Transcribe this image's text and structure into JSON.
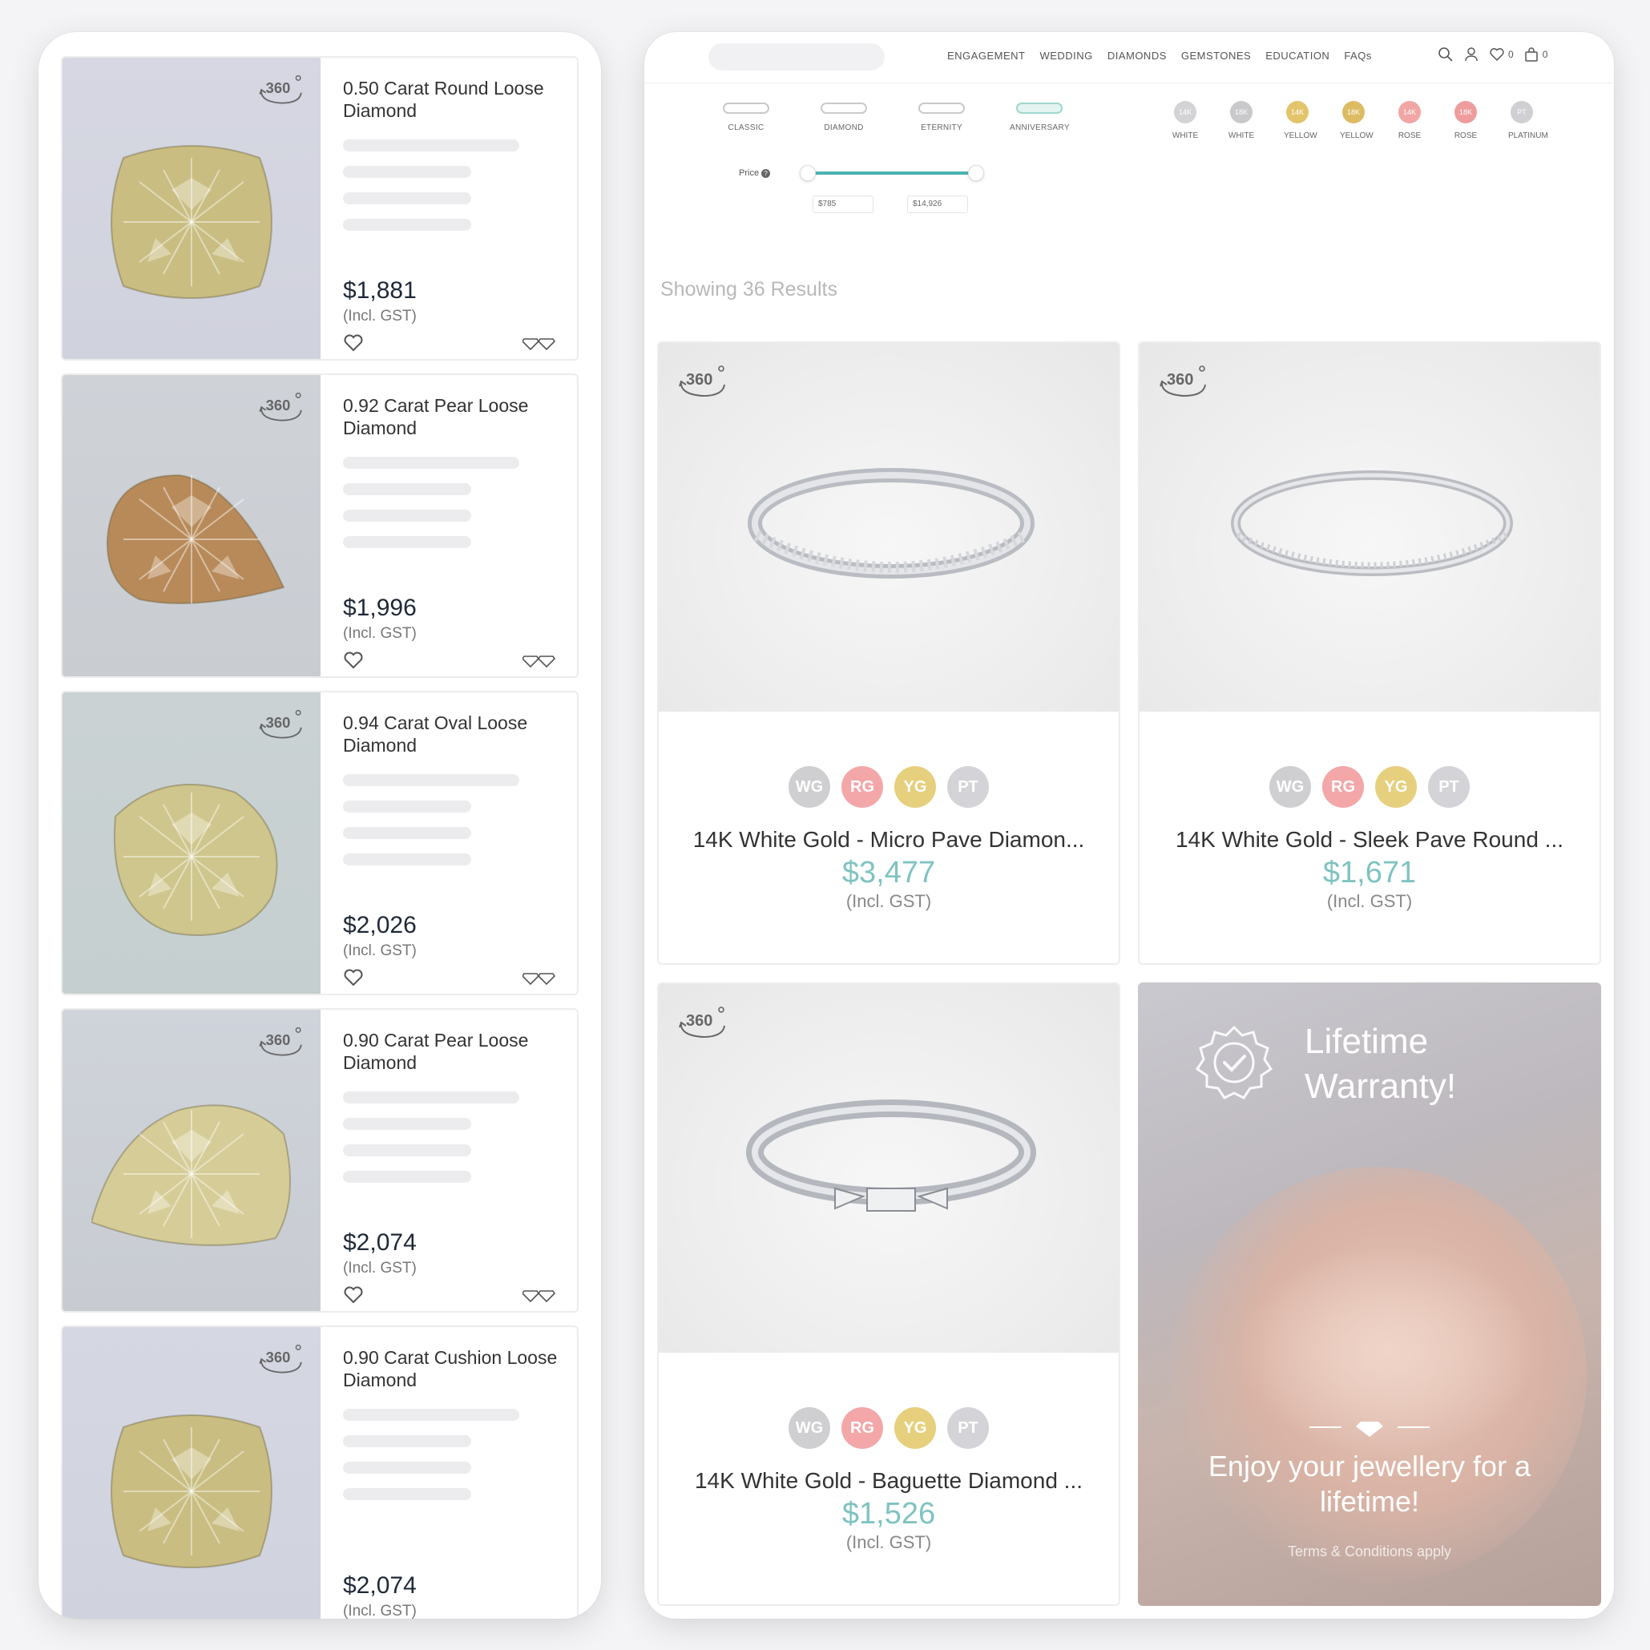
{
  "diamonds": [
    {
      "title": "0.50 Carat Round Loose Diamond",
      "price": "$1,881",
      "gst": "(Incl. GST)",
      "badge": "360",
      "gem_color": "#c9bd82"
    },
    {
      "title": "0.92 Carat Pear Loose Diamond",
      "price": "$1,996",
      "gst": "(Incl. GST)",
      "badge": "360",
      "gem_color": "#b88a5a"
    },
    {
      "title": "0.94 Carat Oval Loose Diamond",
      "price": "$2,026",
      "gst": "(Incl. GST)",
      "badge": "360",
      "gem_color": "#cfc68d"
    },
    {
      "title": "0.90 Carat Pear Loose Diamond",
      "price": "$2,074",
      "gst": "(Incl. GST)",
      "badge": "360",
      "gem_color": "#d6cc97"
    },
    {
      "title": "0.90 Carat Cushion Loose Diamond",
      "price": "$2,074",
      "gst": "(Incl. GST)",
      "badge": "360",
      "gem_color": "#c9bd82"
    }
  ],
  "nav": {
    "items": [
      "ENGAGEMENT",
      "WEDDING",
      "DIAMONDS",
      "GEMSTONES",
      "EDUCATION",
      "FAQs"
    ],
    "wishlist_count": "0",
    "cart_count": "0"
  },
  "filters": {
    "styles": [
      {
        "label": "CLASSIC",
        "active": false
      },
      {
        "label": "DIAMOND",
        "active": false
      },
      {
        "label": "ETERNITY",
        "active": false
      },
      {
        "label": "ANNIVERSARY",
        "active": true
      }
    ],
    "metals": [
      {
        "code": "14K",
        "label": "WHITE",
        "color": "#d3d3d6"
      },
      {
        "code": "18K",
        "label": "WHITE",
        "color": "#c9c9cc"
      },
      {
        "code": "14K",
        "label": "YELLOW",
        "color": "#e2c46b"
      },
      {
        "code": "18K",
        "label": "YELLOW",
        "color": "#dcbb62"
      },
      {
        "code": "14K",
        "label": "ROSE",
        "color": "#f1a5a5"
      },
      {
        "code": "18K",
        "label": "ROSE",
        "color": "#ee9c9c"
      },
      {
        "code": "PT",
        "label": "PLATINUM",
        "color": "#cfcfd4"
      }
    ],
    "price_label": "Price",
    "price_min": "$785",
    "price_max": "$14,926"
  },
  "results_text": "Showing 36 Results",
  "products": [
    {
      "title": "14K White Gold - Micro Pave Diamon...",
      "price": "$3,477",
      "gst": "(Incl. GST)",
      "badge": "360"
    },
    {
      "title": "14K White Gold - Sleek Pave Round ...",
      "price": "$1,671",
      "gst": "(Incl. GST)",
      "badge": "360"
    },
    {
      "title": "14K White Gold - Baguette Diamond ...",
      "price": "$1,526",
      "gst": "(Incl. GST)",
      "badge": "360"
    }
  ],
  "swatches": [
    {
      "code": "WG",
      "color": "#cfcfd2"
    },
    {
      "code": "RG",
      "color": "#f3a7a9"
    },
    {
      "code": "YG",
      "color": "#e6cf7d"
    },
    {
      "code": "PT",
      "color": "#d4d4d8"
    }
  ],
  "promo": {
    "headline_line1": "Lifetime",
    "headline_line2": "Warranty!",
    "tagline": "Enjoy your jewellery for a lifetime!",
    "terms": "Terms & Conditions apply"
  },
  "colors": {
    "accent_teal": "#7fc3c1",
    "slider": "#4bb3b1"
  }
}
